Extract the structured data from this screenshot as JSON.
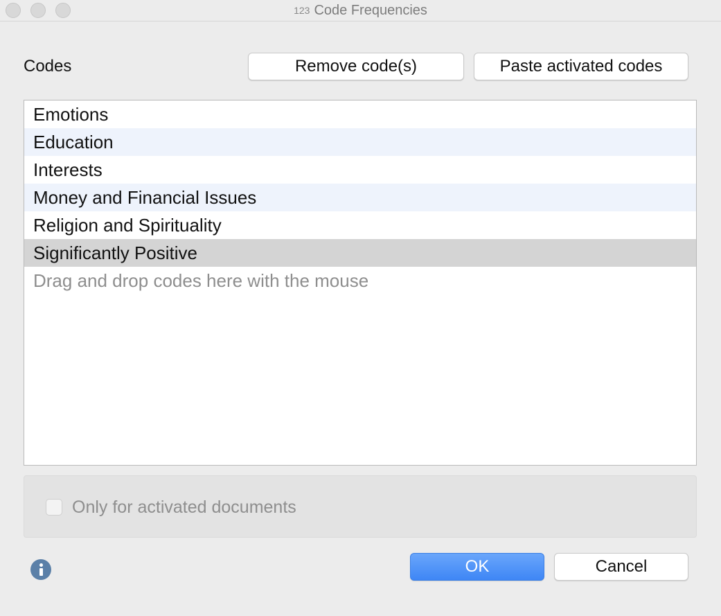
{
  "window": {
    "title": "Code Frequencies",
    "title_icon": "123"
  },
  "codes_section": {
    "label": "Codes",
    "remove_label": "Remove code(s)",
    "paste_label": "Paste activated codes"
  },
  "codes_list": {
    "items": [
      {
        "label": "Emotions"
      },
      {
        "label": "Education"
      },
      {
        "label": "Interests"
      },
      {
        "label": "Money and Financial Issues"
      },
      {
        "label": "Religion and Spirituality"
      },
      {
        "label": "Significantly Positive",
        "selected": true
      }
    ],
    "hint": "Drag and drop codes here with the mouse"
  },
  "options": {
    "activated_docs_label": "Only for activated documents",
    "activated_docs_checked": false
  },
  "footer": {
    "ok_label": "OK",
    "cancel_label": "Cancel",
    "info_icon": "info-icon"
  },
  "colors": {
    "accent": "#3e86f5",
    "selection": "#d4d4d4",
    "alt_row": "#eef3fc",
    "info_icon": "#5b80a8"
  }
}
